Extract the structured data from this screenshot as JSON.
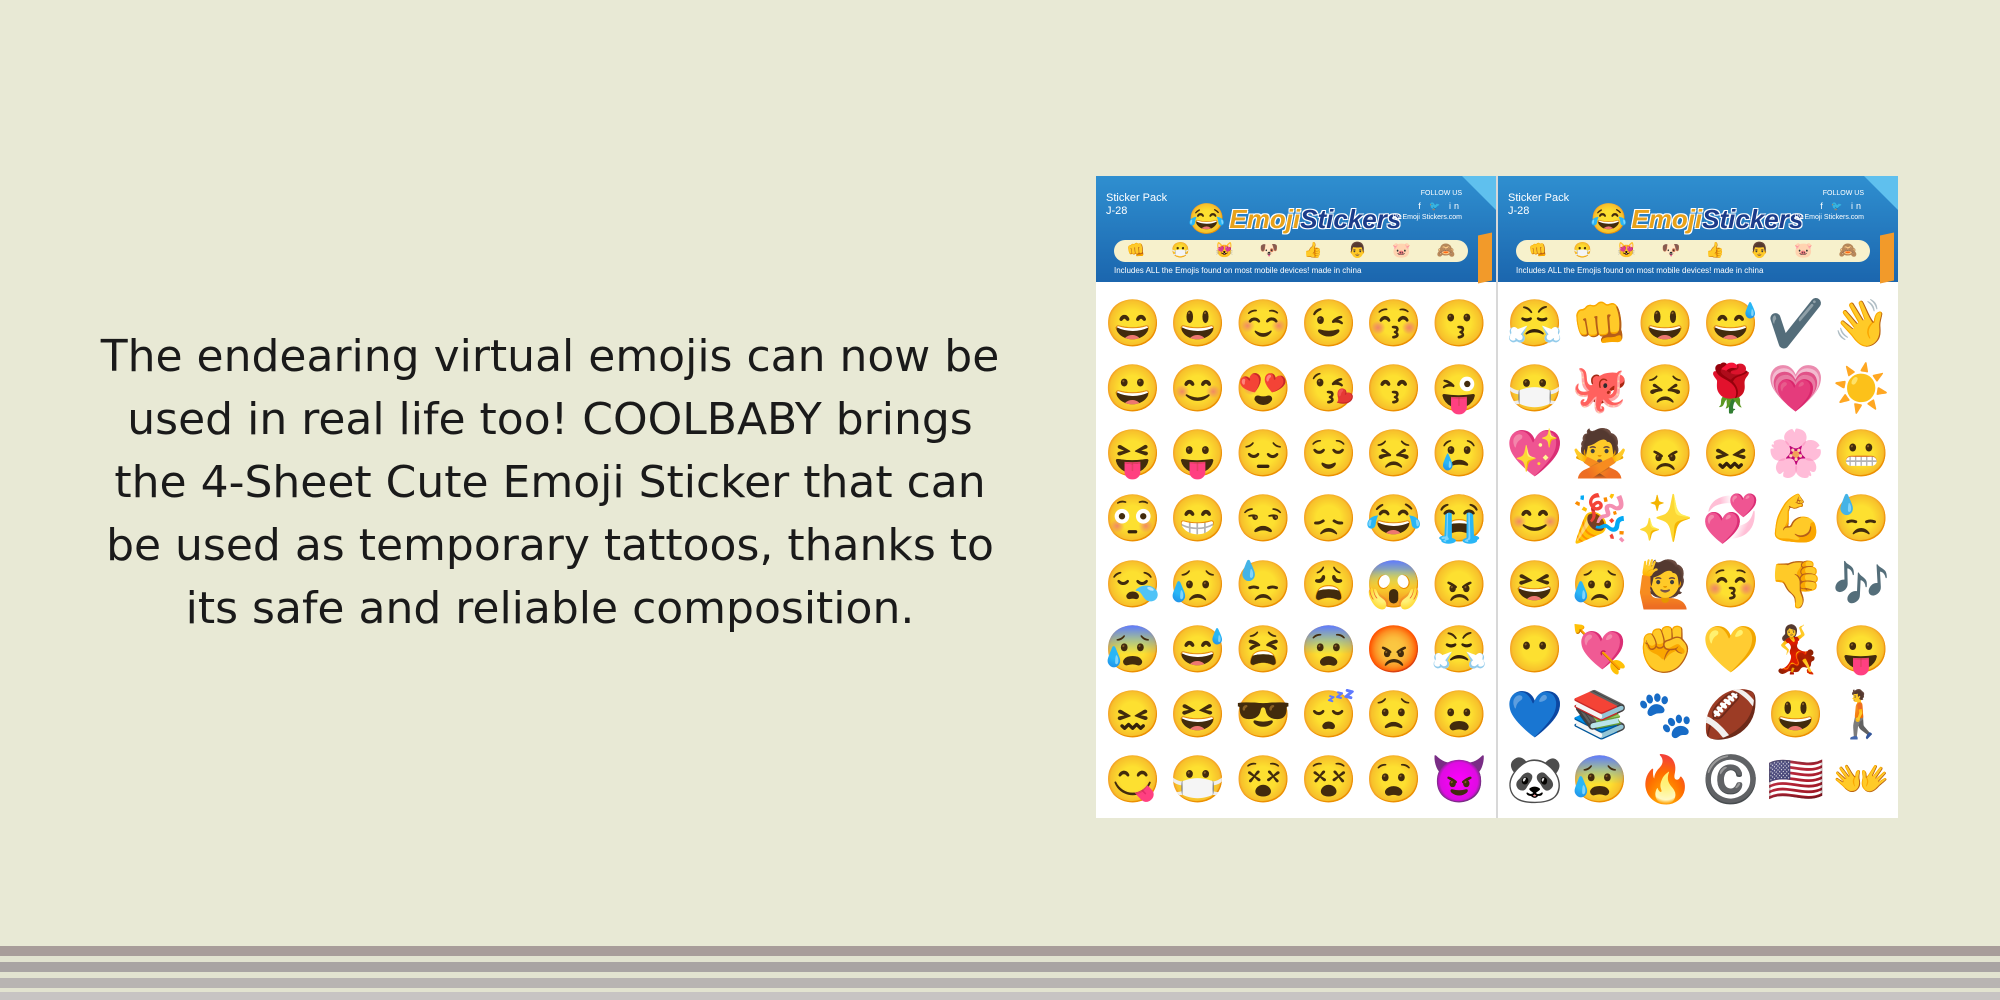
{
  "description": "The endearing virtual emojis can now be used in real life too! COOLBABY brings the 4-Sheet Cute Emoji Sticker that can be used as temporary tattoos, thanks to its safe and reliable composition.",
  "product": {
    "sheets": [
      {
        "pack_label": "Sticker Pack",
        "pack_code": "J-28",
        "brand_icon": "😂",
        "brand_part1": "Emoji",
        "brand_part2": "Stickers",
        "follow_label": "FOLLOW US",
        "social": "f 🐦 in",
        "follow_site": "By Emoji Stickers.com",
        "strip": [
          "👊",
          "😷",
          "😻",
          "🐶",
          "👍",
          "👨",
          "🐷",
          "🙈"
        ],
        "notice": "Includes ALL the Emojis found on most mobile devices!   made in china",
        "emojis": [
          "😄",
          "😃",
          "☺️",
          "😉",
          "😚",
          "😗",
          "😀",
          "😊",
          "😍",
          "😘",
          "😙",
          "😜",
          "😝",
          "😛",
          "😔",
          "😌",
          "😣",
          "😢",
          "😳",
          "😁",
          "😒",
          "😞",
          "😂",
          "😭",
          "😪",
          "😥",
          "😓",
          "😩",
          "😱",
          "😠",
          "😰",
          "😅",
          "😫",
          "😨",
          "😡",
          "😤",
          "😖",
          "😆",
          "😎",
          "😴",
          "😟",
          "😦",
          "😋",
          "😷",
          "😵",
          "😵",
          "😧",
          "😈"
        ]
      },
      {
        "pack_label": "Sticker Pack",
        "pack_code": "J-28",
        "brand_icon": "😂",
        "brand_part1": "Emoji",
        "brand_part2": "Stickers",
        "follow_label": "FOLLOW US",
        "social": "f 🐦 in",
        "follow_site": "By Emoji Stickers.com",
        "strip": [
          "👊",
          "😷",
          "😻",
          "🐶",
          "👍",
          "👨",
          "🐷",
          "🙈"
        ],
        "notice": "Includes ALL the Emojis found on most mobile devices!   made in china",
        "emojis": [
          "😤",
          "👊",
          "😃",
          "😅",
          "✔️",
          "👋",
          "😷",
          "🐙",
          "😣",
          "🌹",
          "💗",
          "☀️",
          "💖",
          "🙅",
          "😠",
          "😖",
          "🌸",
          "😬",
          "😊",
          "🎉",
          "✨",
          "💞",
          "💪",
          "😓",
          "😆",
          "😥",
          "🙋",
          "😚",
          "👎",
          "🎶",
          "😶",
          "💘",
          "✊",
          "💛",
          "💃",
          "😛",
          "💙",
          "📚",
          "🐾",
          "🏈",
          "😃",
          "🚶",
          "🐼",
          "😰",
          "🔥",
          "©️",
          "🇺🇸",
          "👐"
        ]
      }
    ]
  },
  "colors": {
    "background": "#e8e9d5",
    "text": "#1a1a1a",
    "header_blue": "#1b66ae",
    "stripes": [
      "#a89d9a",
      "#e2e3d0",
      "#a9a4a3",
      "#e2e3d0",
      "#b8b4b2",
      "#e2e3d0",
      "#c7c4c3"
    ]
  }
}
